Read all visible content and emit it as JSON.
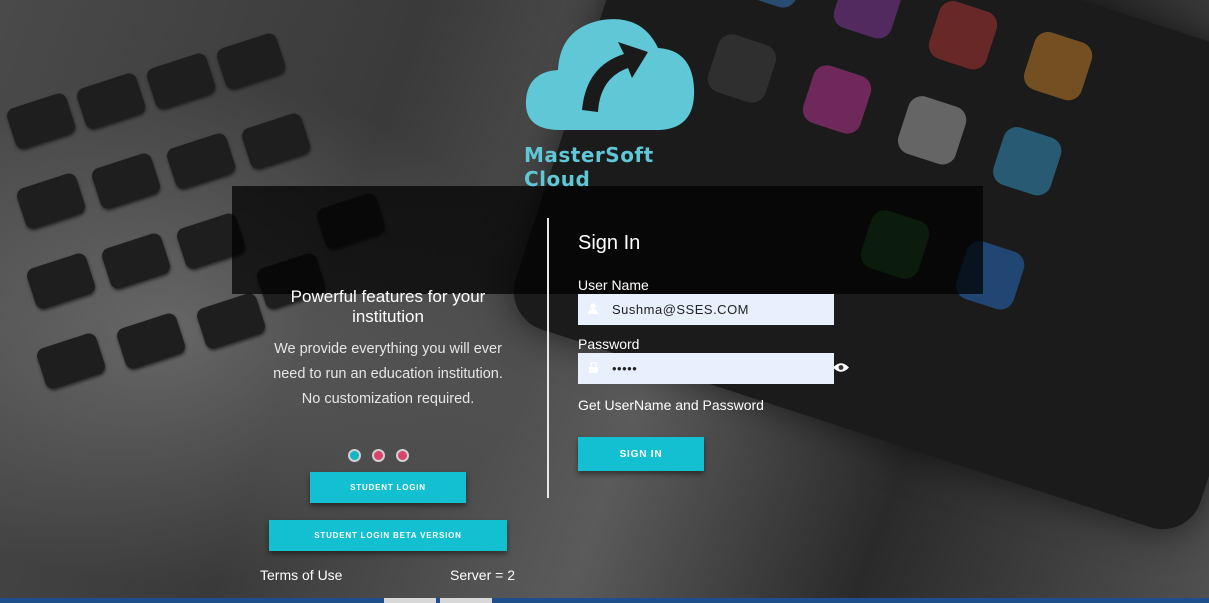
{
  "brand": {
    "name": "MasterSoft Cloud",
    "color": "#5fc7d6"
  },
  "promo": {
    "title": "Powerful features for your institution",
    "description": "We provide everything you will ever need to run an education institution. No customization required.",
    "slides": [
      {
        "color": "#12b5c4",
        "active": true
      },
      {
        "color": "#d9446a",
        "active": false
      },
      {
        "color": "#d9446a",
        "active": false
      }
    ]
  },
  "buttons": {
    "student_login": "STUDENT LOGIN",
    "student_login_beta": "STUDENT LOGIN BETA VERSION",
    "sign_in": "SIGN IN"
  },
  "footer": {
    "terms": "Terms of Use",
    "server": "Server = 2"
  },
  "signin": {
    "title": "Sign In",
    "username_label": "User Name",
    "username_value": "Sushma@SSES.COM",
    "password_label": "Password",
    "password_value": "•••••",
    "get_credentials": "Get UserName and Password"
  },
  "colors": {
    "accent": "#12c0d2",
    "field_bg": "#e8f0fe"
  },
  "icons": {
    "user": "user-icon",
    "lock": "lock-icon",
    "eye": "eye-icon"
  }
}
